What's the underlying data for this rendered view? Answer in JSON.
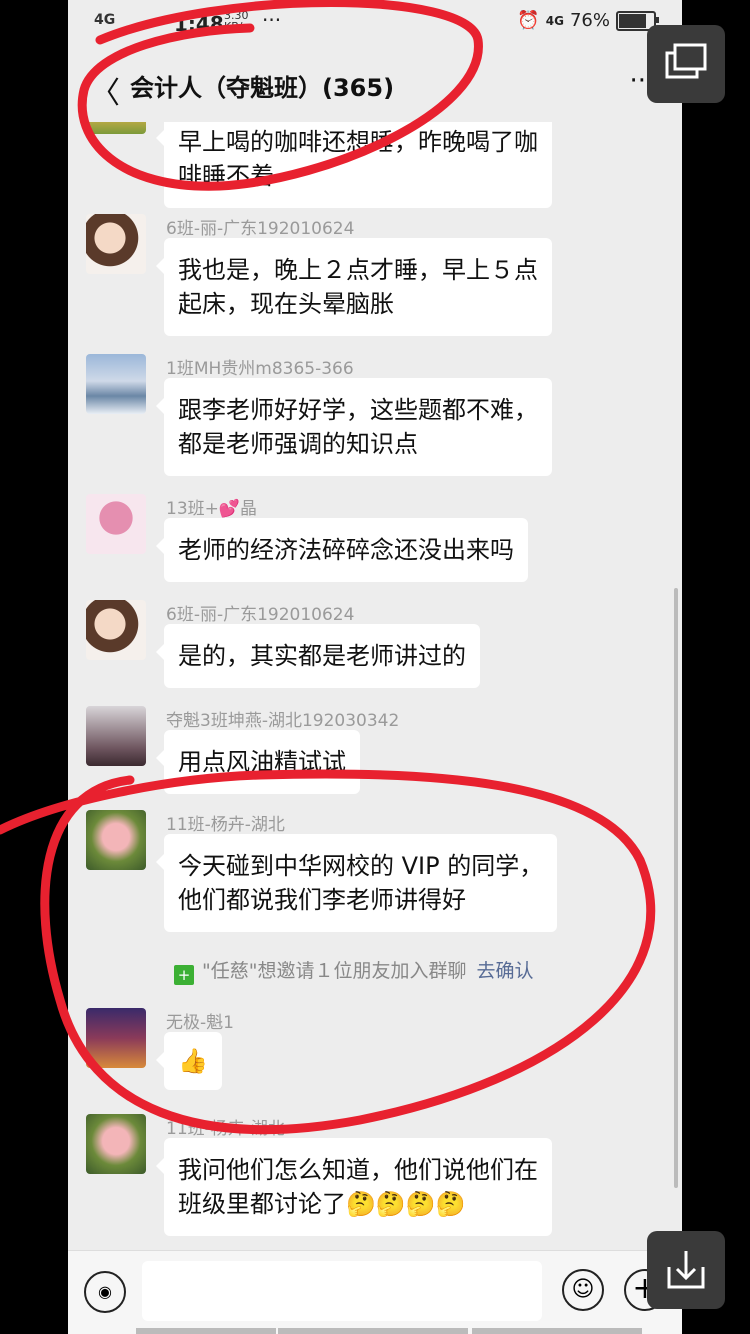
{
  "status": {
    "network": "4G",
    "time": "1:48",
    "speed_value": "3.30",
    "speed_unit": "KB/s",
    "dots": "···",
    "net_right": "4G",
    "battery": "76%",
    "battery_level": 0.76
  },
  "header": {
    "back": "〈",
    "title": "会计人（夺魁班）(365)",
    "more": "··"
  },
  "messages": [
    {
      "sender": "",
      "lines": [
        "早上喝的咖啡还想睡，昨晚喝了咖",
        "啡睡不着"
      ]
    },
    {
      "sender": "6班-丽-广东192010624",
      "lines": [
        "我也是，晚上２点才睡，早上５点",
        "起床，现在头晕脑胀"
      ]
    },
    {
      "sender": "1班MH贵州m8365-366",
      "lines": [
        "跟李老师好好学，这些题都不难，",
        "都是老师强调的知识点"
      ]
    },
    {
      "sender": "13班+💕晶",
      "lines": [
        "老师的经济法碎碎念还没出来吗"
      ]
    },
    {
      "sender": "6班-丽-广东192010624",
      "lines": [
        "是的，其实都是老师讲过的"
      ]
    },
    {
      "sender": "夺魁3班坤燕-湖北192030342",
      "lines": [
        "用点风油精试试"
      ]
    },
    {
      "sender": "11班-杨卉-湖北",
      "lines": [
        "今天碰到中华网校的 VIP 的同学，",
        "他们都说我们李老师讲得好"
      ]
    },
    {
      "sender": "无极-魁1",
      "lines": [
        "👍"
      ]
    },
    {
      "sender": "11班-杨卉-湖北",
      "lines": [
        "我问他们怎么知道，他们说他们在",
        "班级里都讨论了🤔🤔🤔🤔"
      ]
    }
  ],
  "system_notice": {
    "text": "\"任慈\"想邀请１位朋友加入群聊",
    "action": "去确认"
  },
  "input": {
    "voice_icon": "◉",
    "emoji_icon": "☺",
    "plus_icon": "+"
  },
  "colors": {
    "bg": "#ededed",
    "bubble": "#ffffff",
    "annotation": "#e8212f",
    "link": "#576b95"
  }
}
